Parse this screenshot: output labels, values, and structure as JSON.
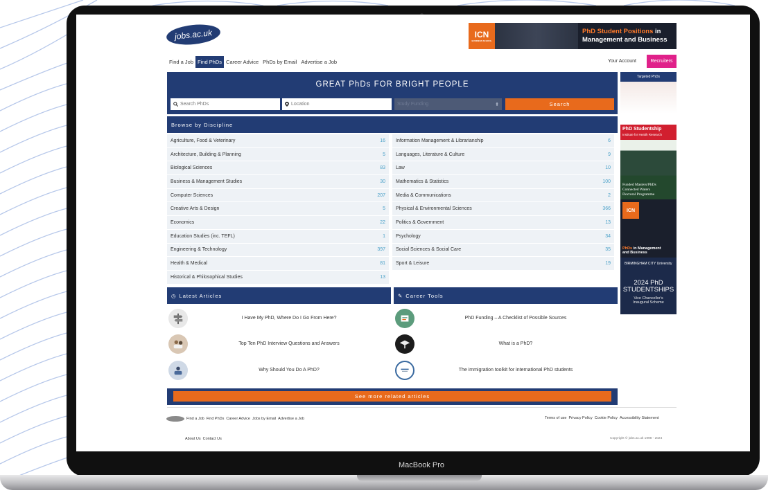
{
  "device": {
    "label": "MacBook Pro"
  },
  "site": {
    "logo_text": "jobs.ac.uk",
    "top_banner": {
      "brand": "ICN",
      "brand_sub": "BUSINESS SCHOOL",
      "accent_text": "PhD Student Positions",
      "text_mid": " in",
      "text_end": "Management and Business"
    },
    "nav": [
      {
        "label": "Find a Job"
      },
      {
        "label": "Find PhDs",
        "active": true
      },
      {
        "label": "Career Advice"
      },
      {
        "label": "PhDs by Email"
      },
      {
        "label": "Advertise a Job"
      }
    ],
    "account_label": "Your Account",
    "recruiters_label": "Recruiters"
  },
  "hero": {
    "title": "GREAT PhDs FOR BRIGHT PEOPLE",
    "search_placeholder": "Search PhDs",
    "location_placeholder": "Location",
    "select_value": "Study Funding",
    "search_button": "Search"
  },
  "browse": {
    "heading": "Browse by Discipline",
    "left": [
      {
        "name": "Agriculture, Food & Veterinary",
        "count": "16"
      },
      {
        "name": "Architecture, Building & Planning",
        "count": "5"
      },
      {
        "name": "Biological Sciences",
        "count": "83"
      },
      {
        "name": "Business & Management Studies",
        "count": "30"
      },
      {
        "name": "Computer Sciences",
        "count": "207"
      },
      {
        "name": "Creative Arts & Design",
        "count": "5"
      },
      {
        "name": "Economics",
        "count": "22"
      },
      {
        "name": "Education Studies (inc. TEFL)",
        "count": "1"
      },
      {
        "name": "Engineering & Technology",
        "count": "397"
      },
      {
        "name": "Health & Medical",
        "count": "81"
      },
      {
        "name": "Historical & Philosophical Studies",
        "count": "13"
      }
    ],
    "right": [
      {
        "name": "Information Management & Librarianship",
        "count": "6"
      },
      {
        "name": "Languages, Literature & Culture",
        "count": "9"
      },
      {
        "name": "Law",
        "count": "10"
      },
      {
        "name": "Mathematics & Statistics",
        "count": "100"
      },
      {
        "name": "Media & Communications",
        "count": "2"
      },
      {
        "name": "Physical & Environmental Sciences",
        "count": "366"
      },
      {
        "name": "Politics & Government",
        "count": "13"
      },
      {
        "name": "Psychology",
        "count": "34"
      },
      {
        "name": "Social Sciences & Social Care",
        "count": "35"
      },
      {
        "name": "Sport & Leisure",
        "count": "19"
      }
    ]
  },
  "articles": {
    "heading": "Latest Articles",
    "items": [
      {
        "title": "I Have My PhD, Where Do I Go From Here?"
      },
      {
        "title": "Top Ten PhD Interview Questions and Answers"
      },
      {
        "title": "Why Should You Do A PhD?"
      }
    ]
  },
  "tools": {
    "heading": "Career Tools",
    "items": [
      {
        "title": "PhD Funding – A Checklist of Possible Sources"
      },
      {
        "title": "What is a PhD?"
      },
      {
        "title": "The immigration toolkit for international PhD students"
      }
    ]
  },
  "more_label": "See more related articles",
  "footer": {
    "links": [
      "Find a Job",
      "Find PhDs",
      "Career Advice",
      "Jobs by Email",
      "Advertise a Job"
    ],
    "right_links": [
      "Terms of use",
      "Privacy Policy",
      "Cookie Policy",
      "Accessibility Statement"
    ],
    "bottom_links": [
      "About Us",
      "Contact Us"
    ],
    "copyright": "Copyright © jobs.ac.uk 1998 - 2024"
  },
  "sidebar": {
    "heading": "Targeted PhDs",
    "ad1_title": "PhD Studentship",
    "ad1_sub": "Institute for Health Research",
    "ad2_line1": "Funded Masters/PhDs",
    "ad2_line2": "Connected Waters",
    "ad2_line3": "Doctoral Programme",
    "ad3_brand": "ICN",
    "ad3_accent": "PhDs",
    "ad3_text1": " in Management",
    "ad3_text2": "and Business",
    "ad4_org": "BIRMINGHAM CITY University",
    "ad4_line1": "2024 PhD",
    "ad4_line2": "STUDENTSHIPS",
    "ad4_sub1": "Vice Chancellor's",
    "ad4_sub2": "Inaugural Scheme"
  },
  "colors": {
    "navy": "#223c74",
    "orange": "#e86a1c",
    "pink": "#e0218a",
    "count_blue": "#4aa0c8"
  }
}
